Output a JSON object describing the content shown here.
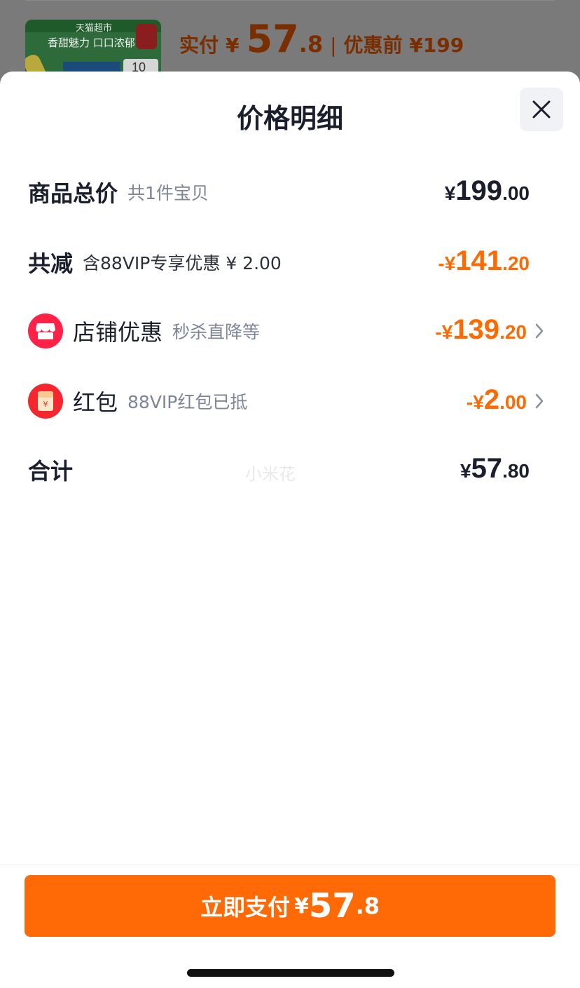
{
  "background": {
    "thumb_brand": "天猫超市",
    "thumb_slogan": "香甜魅力 口口浓郁",
    "thumb_number": "10",
    "paid_label": "实付",
    "paid_yen": "¥",
    "paid_int": "57",
    "paid_dec": ".8",
    "separator": "|",
    "orig_label": "优惠前 ¥199"
  },
  "sheet": {
    "title": "价格明细"
  },
  "rows": {
    "total": {
      "label": "商品总价",
      "sub": "共1件宝贝",
      "prefix": "¥",
      "int": "199",
      "dec": ".00"
    },
    "reduce": {
      "label": "共减",
      "sub": "含88VIP专享优惠 ¥ 2.00",
      "prefix": "-¥",
      "int": "141",
      "dec": ".20"
    },
    "shop": {
      "label": "店铺优惠",
      "sub": "秒杀直降等",
      "prefix": "-¥",
      "int": "139",
      "dec": ".20"
    },
    "redpacket": {
      "label": "红包",
      "sub": "88VIP红包已抵",
      "prefix": "-¥",
      "int": "2",
      "dec": ".00",
      "icon_glyph": "¥"
    },
    "sum": {
      "label": "合计",
      "prefix": "¥",
      "int": "57",
      "dec": ".80"
    }
  },
  "watermark": "小米花",
  "pay_button": {
    "label": "立即支付",
    "yen": "¥",
    "int": "57",
    "dec": ".8"
  },
  "colors": {
    "accent": "#ff6a00",
    "pay_button": "#ff6a06",
    "shop_icon": "#ff2146",
    "text": "#1a1f2b",
    "muted": "#7e8594"
  }
}
